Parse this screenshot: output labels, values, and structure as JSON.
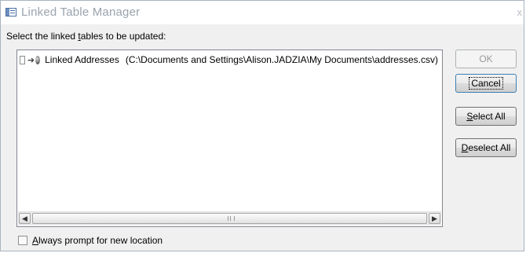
{
  "window": {
    "title": "Linked Table Manager",
    "close_glyph": "x"
  },
  "instruction": {
    "pre": "Select the linked ",
    "accel": "t",
    "post": "ables to be updated:"
  },
  "tables": [
    {
      "checked": false,
      "name": "Linked Addresses",
      "path": "(C:\\Documents and Settings\\Alison.JADZIA\\My Documents\\addresses.csv)",
      "icon": "linked-text-table-icon"
    }
  ],
  "scrollbar": {
    "left_glyph": "◀",
    "right_glyph": "▶"
  },
  "buttons": {
    "ok": {
      "label": "OK",
      "enabled": false
    },
    "cancel": {
      "label": "Cancel",
      "focused": true
    },
    "select_all": {
      "accel": "S",
      "rest": "elect All"
    },
    "deselect_all": {
      "accel": "D",
      "rest": "eselect All"
    }
  },
  "always_prompt": {
    "checked": false,
    "accel": "A",
    "rest": "lways prompt for new location"
  }
}
